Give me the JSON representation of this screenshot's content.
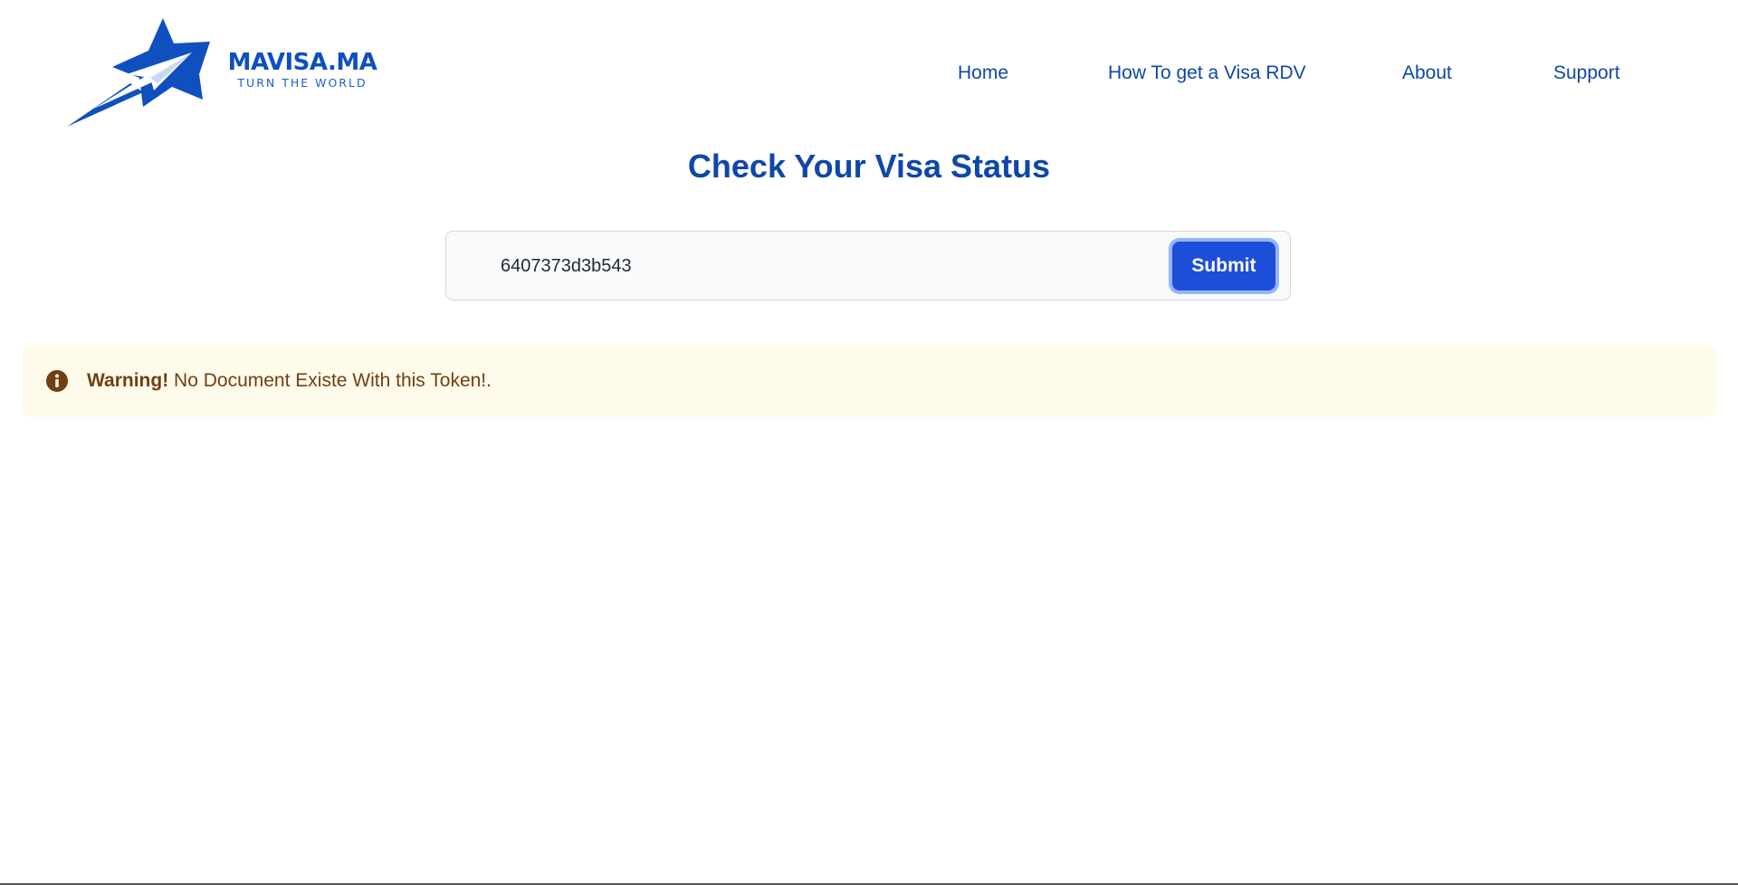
{
  "brand": {
    "name": "MAVISA.MA",
    "tagline": "TURN THE WORLD"
  },
  "nav": {
    "home": "Home",
    "how_to": "How To get a Visa RDV",
    "about": "About",
    "support": "Support"
  },
  "main": {
    "title": "Check Your Visa Status",
    "search": {
      "value": "6407373d3b543",
      "submit_label": "Submit"
    },
    "alert": {
      "icon": "info-circle-icon",
      "strong": "Warning!",
      "message": " No Document Existe With this Token!."
    }
  },
  "colors": {
    "brand_blue": "#0f47a8",
    "button_blue": "#1d4ed8",
    "alert_bg": "#fefbea",
    "alert_text": "#713f12"
  }
}
